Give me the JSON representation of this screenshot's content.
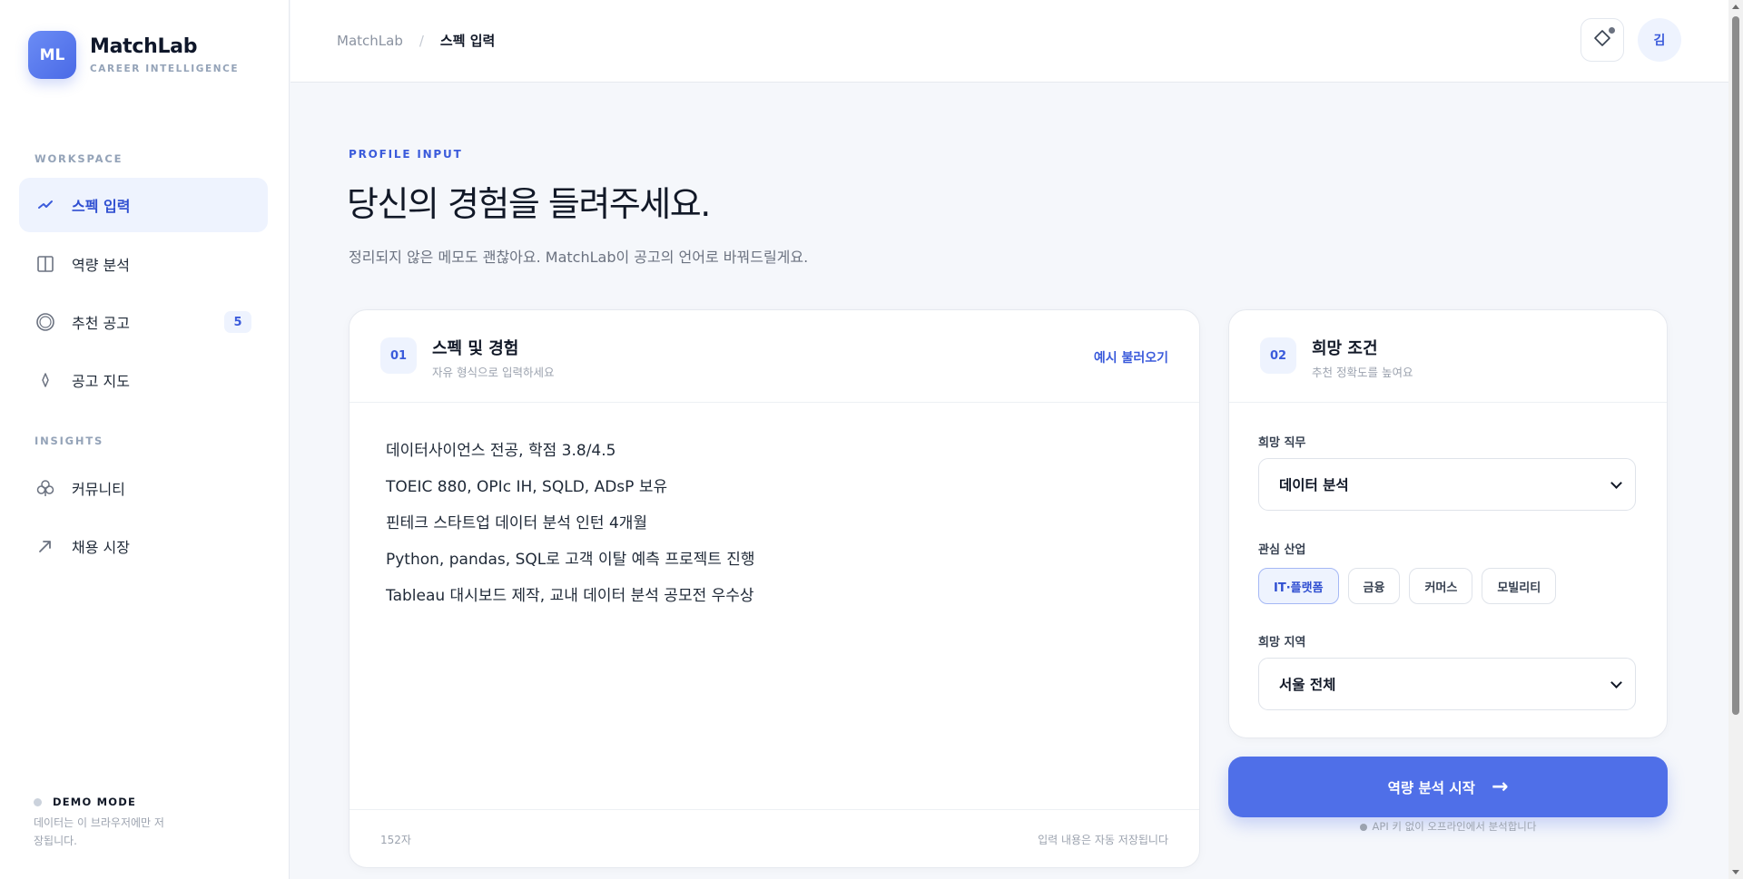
{
  "brand": {
    "logo": "ML",
    "name": "MatchLab",
    "tagline": "CAREER INTELLIGENCE"
  },
  "sidebar": {
    "workspace_label": "WORKSPACE",
    "workspace_items": [
      {
        "label": "스펙 입력",
        "icon": "spark-icon",
        "active": true
      },
      {
        "label": "역량 분석",
        "icon": "columns-icon"
      },
      {
        "label": "추천 공고",
        "icon": "target-icon",
        "badge": "5"
      },
      {
        "label": "공고 지도",
        "icon": "pin-icon"
      }
    ],
    "insights_label": "INSIGHTS",
    "insights_items": [
      {
        "label": "커뮤니티",
        "icon": "club-icon"
      },
      {
        "label": "채용 시장",
        "icon": "trend-arrow-icon"
      }
    ],
    "demo": {
      "title": "DEMO MODE",
      "desc": "데이터는 이 브라우저에만 저장됩니다."
    }
  },
  "header": {
    "breadcrumb_root": "MatchLab",
    "breadcrumb_sep": "/",
    "breadcrumb_current": "스펙 입력",
    "avatar": "김"
  },
  "main": {
    "eyebrow": "PROFILE INPUT",
    "headline": "당신의 경험을 들려주세요.",
    "lead": "정리되지 않은 메모도 괜찮아요. MatchLab이 공고의 언어로 바꿔드릴게요."
  },
  "spec_card": {
    "step": "01",
    "title": "스펙 및 경험",
    "subtitle": "자유 형식으로 입력하세요",
    "link": "예시 불러오기",
    "lines": [
      "데이터사이언스 전공, 학점 3.8/4.5",
      "TOEIC 880, OPIc IH, SQLD, ADsP 보유",
      "핀테크 스타트업 데이터 분석 인턴 4개월",
      "Python, pandas, SQL로 고객 이탈 예측 프로젝트 진행",
      "Tableau 대시보드 제작, 교내 데이터 분석 공모전 우수상"
    ],
    "char_count": "152자",
    "autosave": "입력 내용은 자동 저장됩니다"
  },
  "pref_card": {
    "step": "02",
    "title": "희망 조건",
    "subtitle": "추천 정확도를 높여요",
    "job_label": "희망 직무",
    "job_value": "데이터 분석",
    "industry_label": "관심 산업",
    "industries": [
      {
        "label": "IT·플랫폼",
        "active": true
      },
      {
        "label": "금융"
      },
      {
        "label": "커머스"
      },
      {
        "label": "모빌리티"
      }
    ],
    "region_label": "희망 지역",
    "region_value": "서울 전체"
  },
  "cta": {
    "label": "역량 분석 시작",
    "arrow": "→",
    "note": "API 키 없이 오프라인에서 분석합니다"
  },
  "colors": {
    "accent": "#4f6fe8",
    "accent_text": "#3b5bdb",
    "accent_bg": "#eef3fe"
  }
}
